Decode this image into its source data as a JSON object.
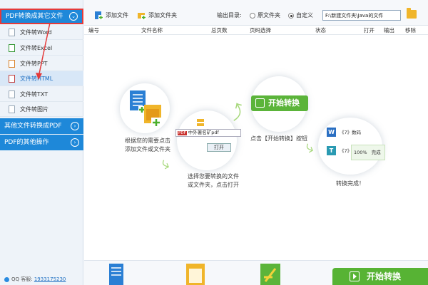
{
  "sidebar": {
    "categories": [
      {
        "label": "PDF转换成其它文件",
        "chevron": "⌄"
      },
      {
        "label": "其他文件转换成PDF",
        "chevron": "›"
      },
      {
        "label": "PDF的其他操作",
        "chevron": "›"
      }
    ],
    "items": [
      {
        "label": "文件转Word"
      },
      {
        "label": "文件转Excel"
      },
      {
        "label": "文件转PPT"
      },
      {
        "label": "文件转HTML"
      },
      {
        "label": "文件转TXT"
      },
      {
        "label": "文件转图片"
      }
    ],
    "qq_label": "QQ 客服:",
    "qq_number": "1933175230"
  },
  "toolbar": {
    "add_file": "添加文件",
    "add_folder": "添加文件夹",
    "output_label": "输出目录:",
    "option_original": "原文件夹",
    "option_custom": "自定义",
    "path_value": "F:\\新建文件夹\\Java的文件"
  },
  "table": {
    "headers": [
      "编号",
      "文件名称",
      "总页数",
      "页码选择",
      "状态",
      "打开",
      "输出",
      "移除"
    ]
  },
  "guide": {
    "step1": "根据您的需要点击\n添加文件或文件夹",
    "step2": "选择您要转换的文件\n或文件夹，点击打开",
    "step3": "点击【开始转换】按钮",
    "step4": "转换完成！",
    "start_label": "开始转换",
    "dialog_file": "中外著名矿",
    "dialog_ext": "pdf",
    "dialog_open": "打开",
    "doc1": "《7》数码",
    "doc2": "《7》数码",
    "progress": "100%",
    "done": "完成"
  },
  "bottom": {
    "start_label": "开始转换"
  },
  "colors": {
    "sidebar_active": "#1e88d9",
    "green": "#57b334",
    "highlight": "#e43a3a"
  }
}
